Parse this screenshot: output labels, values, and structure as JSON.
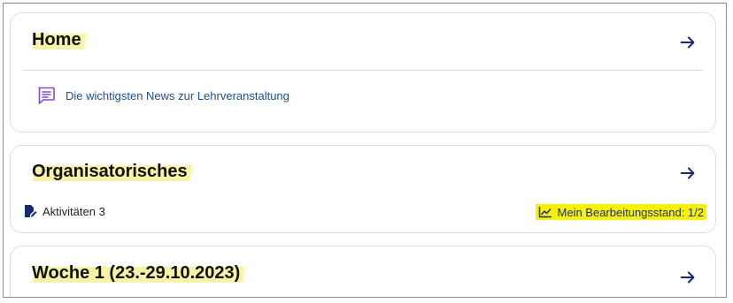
{
  "sections": [
    {
      "title": "Home",
      "items": [
        {
          "icon": "message-icon",
          "label": "Die wichtigsten News zur Lehrveranstaltung"
        }
      ]
    },
    {
      "title": "Organisatorisches",
      "activities_label": "Aktivitäten 3",
      "progress_label": "Mein Bearbeitungsstand: 1/2",
      "progress_fraction": 0.5
    },
    {
      "title": "Woche 1 (23.-29.10.2023)"
    }
  ],
  "colors": {
    "title_highlight": "#f6f2a8",
    "status_highlight": "#f7f200",
    "link_blue": "#1f4e8c",
    "icon_purple": "#7a4fd6",
    "arrow_navy": "#1a2b6d"
  },
  "icons": {
    "arrow": "arrow-right-icon",
    "news": "message-icon",
    "activities": "edit-file-icon",
    "progress": "trend-chart-icon"
  }
}
